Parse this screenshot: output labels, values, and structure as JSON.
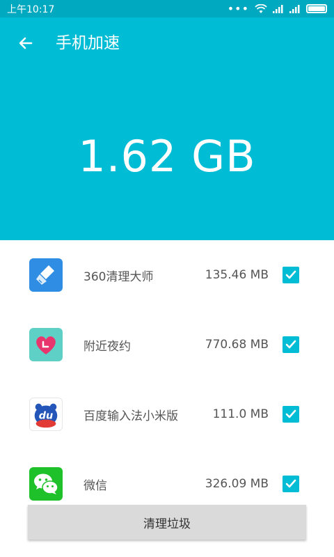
{
  "status_bar": {
    "time": "上午10:17"
  },
  "header": {
    "title": "手机加速",
    "memory_value": "1.62 GB"
  },
  "apps": [
    {
      "name": "360清理大师",
      "size": "135.46 MB",
      "checked": true,
      "icon": "broom-icon"
    },
    {
      "name": "附近夜约",
      "size": "770.68 MB",
      "checked": true,
      "icon": "heart-icon"
    },
    {
      "name": "百度输入法小米版",
      "size": "111.0 MB",
      "checked": true,
      "icon": "du-icon"
    },
    {
      "name": "微信",
      "size": "326.09 MB",
      "checked": true,
      "icon": "wechat-icon"
    }
  ],
  "footer": {
    "clean_label": "清理垃圾"
  },
  "colors": {
    "primary": "#00bcd4",
    "status_bar": "#00a9c0",
    "button": "#dadada"
  }
}
